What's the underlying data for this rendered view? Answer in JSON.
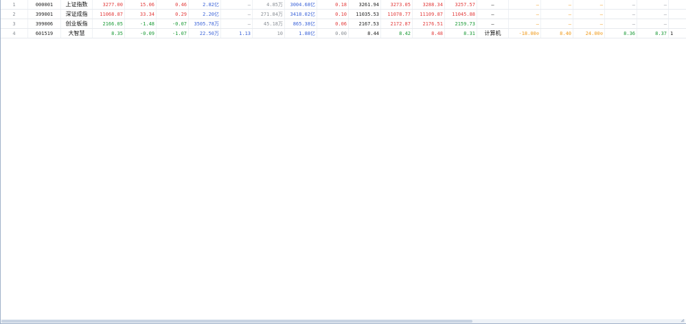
{
  "rows": [
    {
      "idx": "1",
      "code": "000001",
      "name": "上证指数",
      "price": "3277.00",
      "change": "15.06",
      "pct": "0.46",
      "amount": "2.82亿",
      "c5": "—",
      "vol": "4.85万",
      "turnover": "3004.68亿",
      "c8": "0.18",
      "prev": "3261.94",
      "open": "3273.05",
      "high": "3288.34",
      "low": "3257.57",
      "industry": "—",
      "c16": "—",
      "c17": "—",
      "c18": "—",
      "c19": "—",
      "c20": "—"
    },
    {
      "idx": "2",
      "code": "399001",
      "name": "深证成指",
      "price": "11068.87",
      "change": "33.34",
      "pct": "0.29",
      "amount": "2.20亿",
      "c5": "—",
      "vol": "271.84万",
      "turnover": "3418.02亿",
      "c8": "0.10",
      "prev": "11035.53",
      "open": "11078.77",
      "high": "11109.87",
      "low": "11045.88",
      "industry": "—",
      "c16": "—",
      "c17": "—",
      "c18": "—",
      "c19": "—",
      "c20": "—"
    },
    {
      "idx": "3",
      "code": "399006",
      "name": "创业板指",
      "price": "2166.05",
      "change": "-1.48",
      "pct": "-0.07",
      "amount": "3505.78万",
      "c5": "—",
      "vol": "45.18万",
      "turnover": "865.38亿",
      "c8": "0.06",
      "prev": "2167.53",
      "open": "2172.87",
      "high": "2176.51",
      "low": "2159.73",
      "industry": "—",
      "c16": "—",
      "c17": "—",
      "c18": "—",
      "c19": "—",
      "c20": "—"
    },
    {
      "idx": "4",
      "code": "601519",
      "name": "大智慧",
      "price": "8.35",
      "change": "-0.09",
      "pct": "-1.07",
      "amount": "22.50万",
      "c5": "1.13",
      "vol": "10",
      "turnover": "1.88亿",
      "c8": "0.00",
      "prev": "8.44",
      "open": "8.42",
      "high": "8.48",
      "low": "8.31",
      "industry": "计算机",
      "c16": "-18.00⊙",
      "c17": "8.40",
      "c18": "24.00⊙",
      "c19": "8.36",
      "c20": "8.37",
      "c21": "1"
    }
  ],
  "colors": {
    "up": "#e23b3b",
    "down": "#1a9a36",
    "amount": "#3b63d8",
    "neutral": "#8a8f96",
    "special": "#f09a1a"
  }
}
